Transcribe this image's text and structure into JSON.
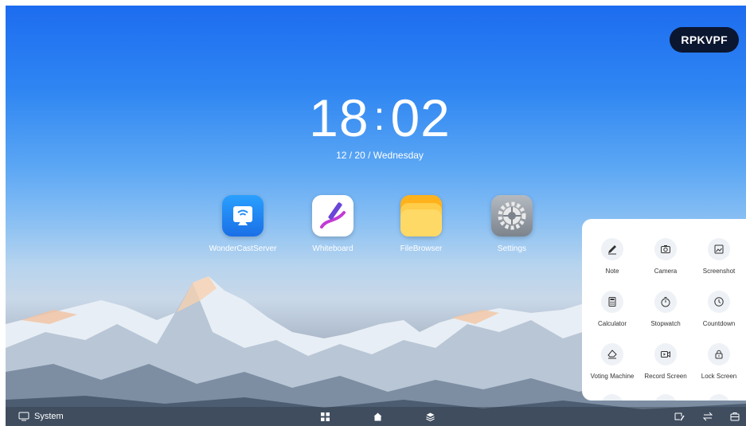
{
  "badge": "RPKVPF",
  "clock": {
    "hours": "18",
    "sep": ":",
    "minutes": "02"
  },
  "date": "12 / 20 / Wednesday",
  "apps": [
    {
      "label": "WonderCastServer",
      "icon": "cast-icon",
      "color": "#1f8bf5"
    },
    {
      "label": "Whiteboard",
      "icon": "pen-icon",
      "color": "#ffffff"
    },
    {
      "label": "FileBrowser",
      "icon": "folder-icon",
      "color": "#ffb21c"
    },
    {
      "label": "Settings",
      "icon": "gear-icon",
      "color": "#9aa0a8"
    }
  ],
  "tools": [
    {
      "label": "Note",
      "icon": "pen-icon"
    },
    {
      "label": "Camera",
      "icon": "camera-icon"
    },
    {
      "label": "Screenshot",
      "icon": "screenshot-icon"
    },
    {
      "label": "Calculator",
      "icon": "calculator-icon"
    },
    {
      "label": "Stopwatch",
      "icon": "stopwatch-icon"
    },
    {
      "label": "Countdown",
      "icon": "countdown-icon"
    },
    {
      "label": "Voting Machine",
      "icon": "eraser-icon"
    },
    {
      "label": "Record Screen",
      "icon": "record-icon"
    },
    {
      "label": "Lock Screen",
      "icon": "lock-icon"
    }
  ],
  "taskbar": {
    "system_label": "System",
    "center_icons": [
      "apps-grid-icon",
      "home-icon",
      "layers-icon"
    ],
    "right_icons": [
      "annotate-icon",
      "switch-icon",
      "toolbox-icon"
    ]
  }
}
